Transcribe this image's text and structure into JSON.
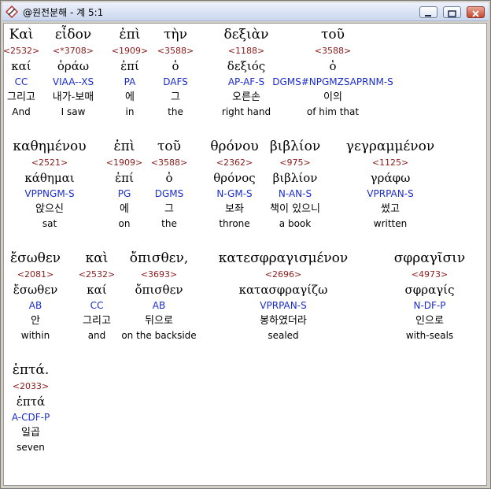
{
  "window": {
    "title": "@원전분해 - 계 5:1"
  },
  "lines": [
    [
      {
        "greek": "Καὶ",
        "strong": "<2532>",
        "lexeme": "καί",
        "morph": "CC",
        "korean": "그리고",
        "english": "And"
      },
      {
        "greek": "εἶδον",
        "strong": "<*3708>",
        "lexeme": "ὁράω",
        "morph": "VIAA--XS",
        "korean": "내가-보매",
        "english": "I saw"
      },
      {
        "greek": "ἐπὶ",
        "strong": "<1909>",
        "lexeme": "ἐπί",
        "morph": "PA",
        "korean": "에",
        "english": "in"
      },
      {
        "greek": "τὴν",
        "strong": "<3588>",
        "lexeme": "ὁ",
        "morph": "DAFS",
        "korean": "그",
        "english": "the"
      },
      {
        "greek": "δεξιὰν",
        "strong": "<1188>",
        "lexeme": "δεξιός",
        "morph": "AP-AF-S",
        "korean": "오른손",
        "english": "right hand"
      },
      {
        "greek": "τοῦ",
        "strong": "<3588>",
        "lexeme": "ὁ",
        "morph": "DGMS#NPGMZSAPRNM-S",
        "korean": "이의",
        "english": "of him that"
      }
    ],
    [
      {
        "greek": "καθημένου",
        "strong": "<2521>",
        "lexeme": "κάθημαι",
        "morph": "VPPNGM-S",
        "korean": "앉으신",
        "english": "sat"
      },
      {
        "greek": "ἐπὶ",
        "strong": "<1909>",
        "lexeme": "ἐπί",
        "morph": "PG",
        "korean": "에",
        "english": "on"
      },
      {
        "greek": "τοῦ",
        "strong": "<3588>",
        "lexeme": "ὁ",
        "morph": "DGMS",
        "korean": "그",
        "english": "the"
      },
      {
        "greek": "θρόνου",
        "strong": "<2362>",
        "lexeme": "θρόνος",
        "morph": "N-GM-S",
        "korean": "보좌",
        "english": "throne"
      },
      {
        "greek": "βιβλίον",
        "strong": "<975>",
        "lexeme": "βιβλίον",
        "morph": "N-AN-S",
        "korean": "책이 있으니",
        "english": "a book"
      },
      {
        "greek": "γεγραμμένον",
        "strong": "<1125>",
        "lexeme": "γράφω",
        "morph": "VPRPAN-S",
        "korean": "썼고",
        "english": "written"
      }
    ],
    [
      {
        "greek": "ἔσωθεν",
        "strong": "<2081>",
        "lexeme": "ἔσωθεν",
        "morph": "AB",
        "korean": "안",
        "english": "within"
      },
      {
        "greek": "καὶ",
        "strong": "<2532>",
        "lexeme": "καί",
        "morph": "CC",
        "korean": "그리고",
        "english": "and"
      },
      {
        "greek": "ὄπισθεν,",
        "strong": "<3693>",
        "lexeme": "ὄπισθεν",
        "morph": "AB",
        "korean": "뒤으로",
        "english": "on the backside"
      },
      {
        "greek": "κατεσφραγισμένον",
        "strong": "<2696>",
        "lexeme": "κατασφραγίζω",
        "morph": "VPRPAN-S",
        "korean": "봉하였더라",
        "english": "sealed"
      },
      {
        "greek": "σφραγῖσιν",
        "strong": "<4973>",
        "lexeme": "σφραγίς",
        "morph": "N-DF-P",
        "korean": "인으로",
        "english": "with-seals"
      }
    ],
    [
      {
        "greek": "ἑπτά.",
        "strong": "<2033>",
        "lexeme": "ἑπτά",
        "morph": "A-CDF-P",
        "korean": "일곱",
        "english": "seven"
      }
    ]
  ]
}
